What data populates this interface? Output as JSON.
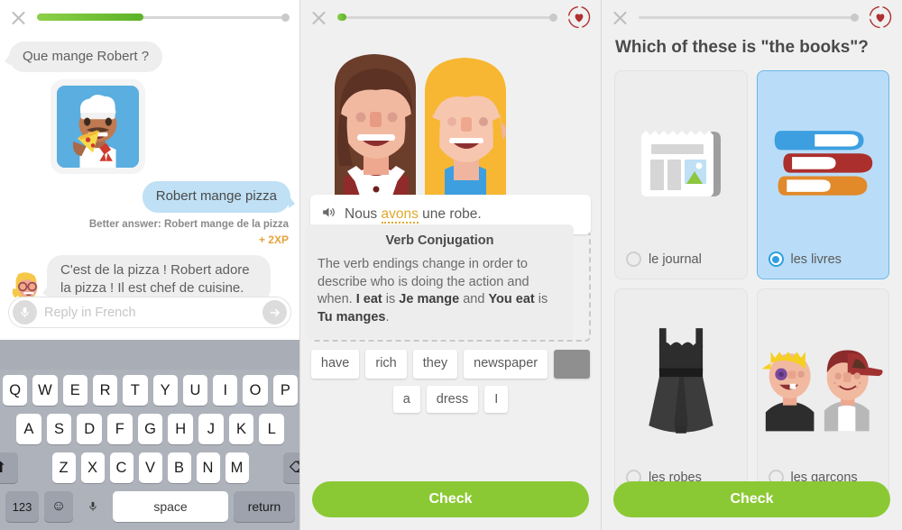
{
  "app": {
    "name": "Duolingo Lesson Screens"
  },
  "panel1": {
    "name": "chatbot-conversation",
    "close_label": "close",
    "progress_percent": 42,
    "messages": [
      {
        "side": "left",
        "type": "text",
        "text": "Que mange Robert ?"
      },
      {
        "side": "left",
        "type": "image",
        "alt": "chef-eating-pizza-illustration"
      },
      {
        "side": "right",
        "type": "text",
        "text": "Robert mange pizza"
      }
    ],
    "better_answer": "Better answer: Robert mange de la pizza",
    "xp": "+ 2XP",
    "npc_reply": "C'est de la pizza ! Robert adore la pizza ! Il est chef de cuisine.",
    "reply_placeholder": "Reply in French",
    "reply_value": "",
    "keyboard": {
      "row1": [
        "Q",
        "W",
        "E",
        "R",
        "T",
        "Y",
        "U",
        "I",
        "O",
        "P"
      ],
      "row2": [
        "A",
        "S",
        "D",
        "F",
        "G",
        "H",
        "J",
        "K",
        "L"
      ],
      "row3": [
        "Z",
        "X",
        "C",
        "V",
        "B",
        "N",
        "M"
      ],
      "shift_label": "⬆",
      "backspace_label": "⌫",
      "numbers_label": "123",
      "emoji_label": "☺",
      "mic_label": "mic",
      "space_label": "space",
      "return_label": "return"
    }
  },
  "panel2": {
    "name": "translate-exercise",
    "progress_percent": 4,
    "hero_alt": "two-smiling-women-illustration",
    "sentence": {
      "pre": "Nous ",
      "highlight": "avons",
      "post": " une robe."
    },
    "tooltip": {
      "title": "Verb Conjugation",
      "text_1": "The verb endings change in order to describe who is doing the action and when. ",
      "bold_1": "I eat",
      "text_2": " is ",
      "bold_2": "Je mange",
      "text_3": " and ",
      "bold_3": "You eat",
      "text_4": " is ",
      "bold_4": "Tu manges",
      "text_5": "."
    },
    "word_bank_row1": [
      "have",
      "rich",
      "they",
      "newspaper"
    ],
    "word_bank_row2": [
      "a",
      "dress",
      "I"
    ],
    "check_label": "Check"
  },
  "panel3": {
    "name": "multiple-choice-exercise",
    "progress_percent": 0,
    "question": "Which of these is \"the books\"?",
    "options": [
      {
        "label": "le journal",
        "art": "newspaper-illustration",
        "selected": false
      },
      {
        "label": "les livres",
        "art": "stack-of-books-illustration",
        "selected": true
      },
      {
        "label": "les robes",
        "art": "black-dress-illustration",
        "selected": false
      },
      {
        "label": "les garçons",
        "art": "two-boys-illustration",
        "selected": false
      }
    ],
    "check_label": "Check"
  },
  "colors": {
    "green": "#8bc934",
    "progress_green": "#5cb228",
    "blue_bubble": "#bfe0f5",
    "selected_blue": "#b9ddf8",
    "radio_blue": "#2e9fe0",
    "xp_orange": "#e8a33d",
    "highlight_gold": "#e0a92e",
    "heart_red": "#b03030",
    "keyboard_bg": "#aeb2bb"
  }
}
